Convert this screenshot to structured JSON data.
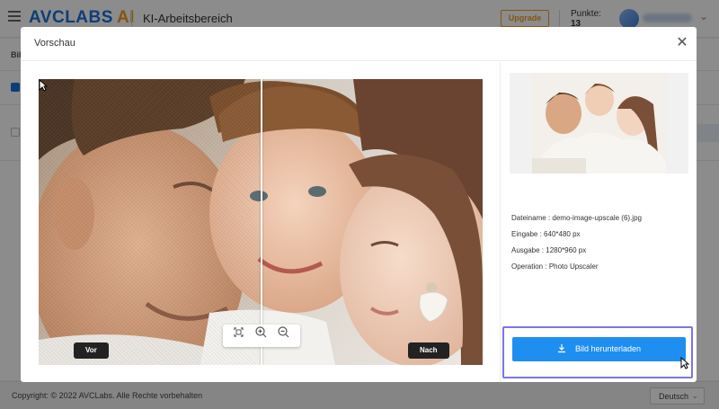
{
  "header": {
    "brand": "AVCLABS",
    "brand_ai": "AI",
    "workspace": "KI-Arbeitsbereich",
    "upgrade_label": "Upgrade",
    "points_label": "Punkte:",
    "points_value": "13"
  },
  "background": {
    "tab_label": "Bil"
  },
  "footer": {
    "copyright": "Copyright: © 2022 AVCLabs. Alle Rechte vorbehalten",
    "language": "Deutsch"
  },
  "modal": {
    "title": "Vorschau",
    "close_icon": "close-icon",
    "before_label": "Vor",
    "after_label": "Nach",
    "toolbar_icons": [
      "fit-screen-icon",
      "zoom-in-icon",
      "zoom-out-icon"
    ],
    "info": {
      "filename_label": "Dateiname :",
      "filename_value": "demo-image-upscale (6).jpg",
      "input_label": "Eingabe :",
      "input_value": "640*480 px",
      "output_label": "Ausgabe :",
      "output_value": "1280*960 px",
      "operation_label": "Operation :",
      "operation_value": "Photo Upscaler"
    },
    "download_label": "Bild herunterladen"
  },
  "colors": {
    "brand_blue": "#1d6fd9",
    "brand_orange": "#f39b1d",
    "download_button": "#1f8ef1",
    "highlight_frame": "#7b77e6"
  }
}
